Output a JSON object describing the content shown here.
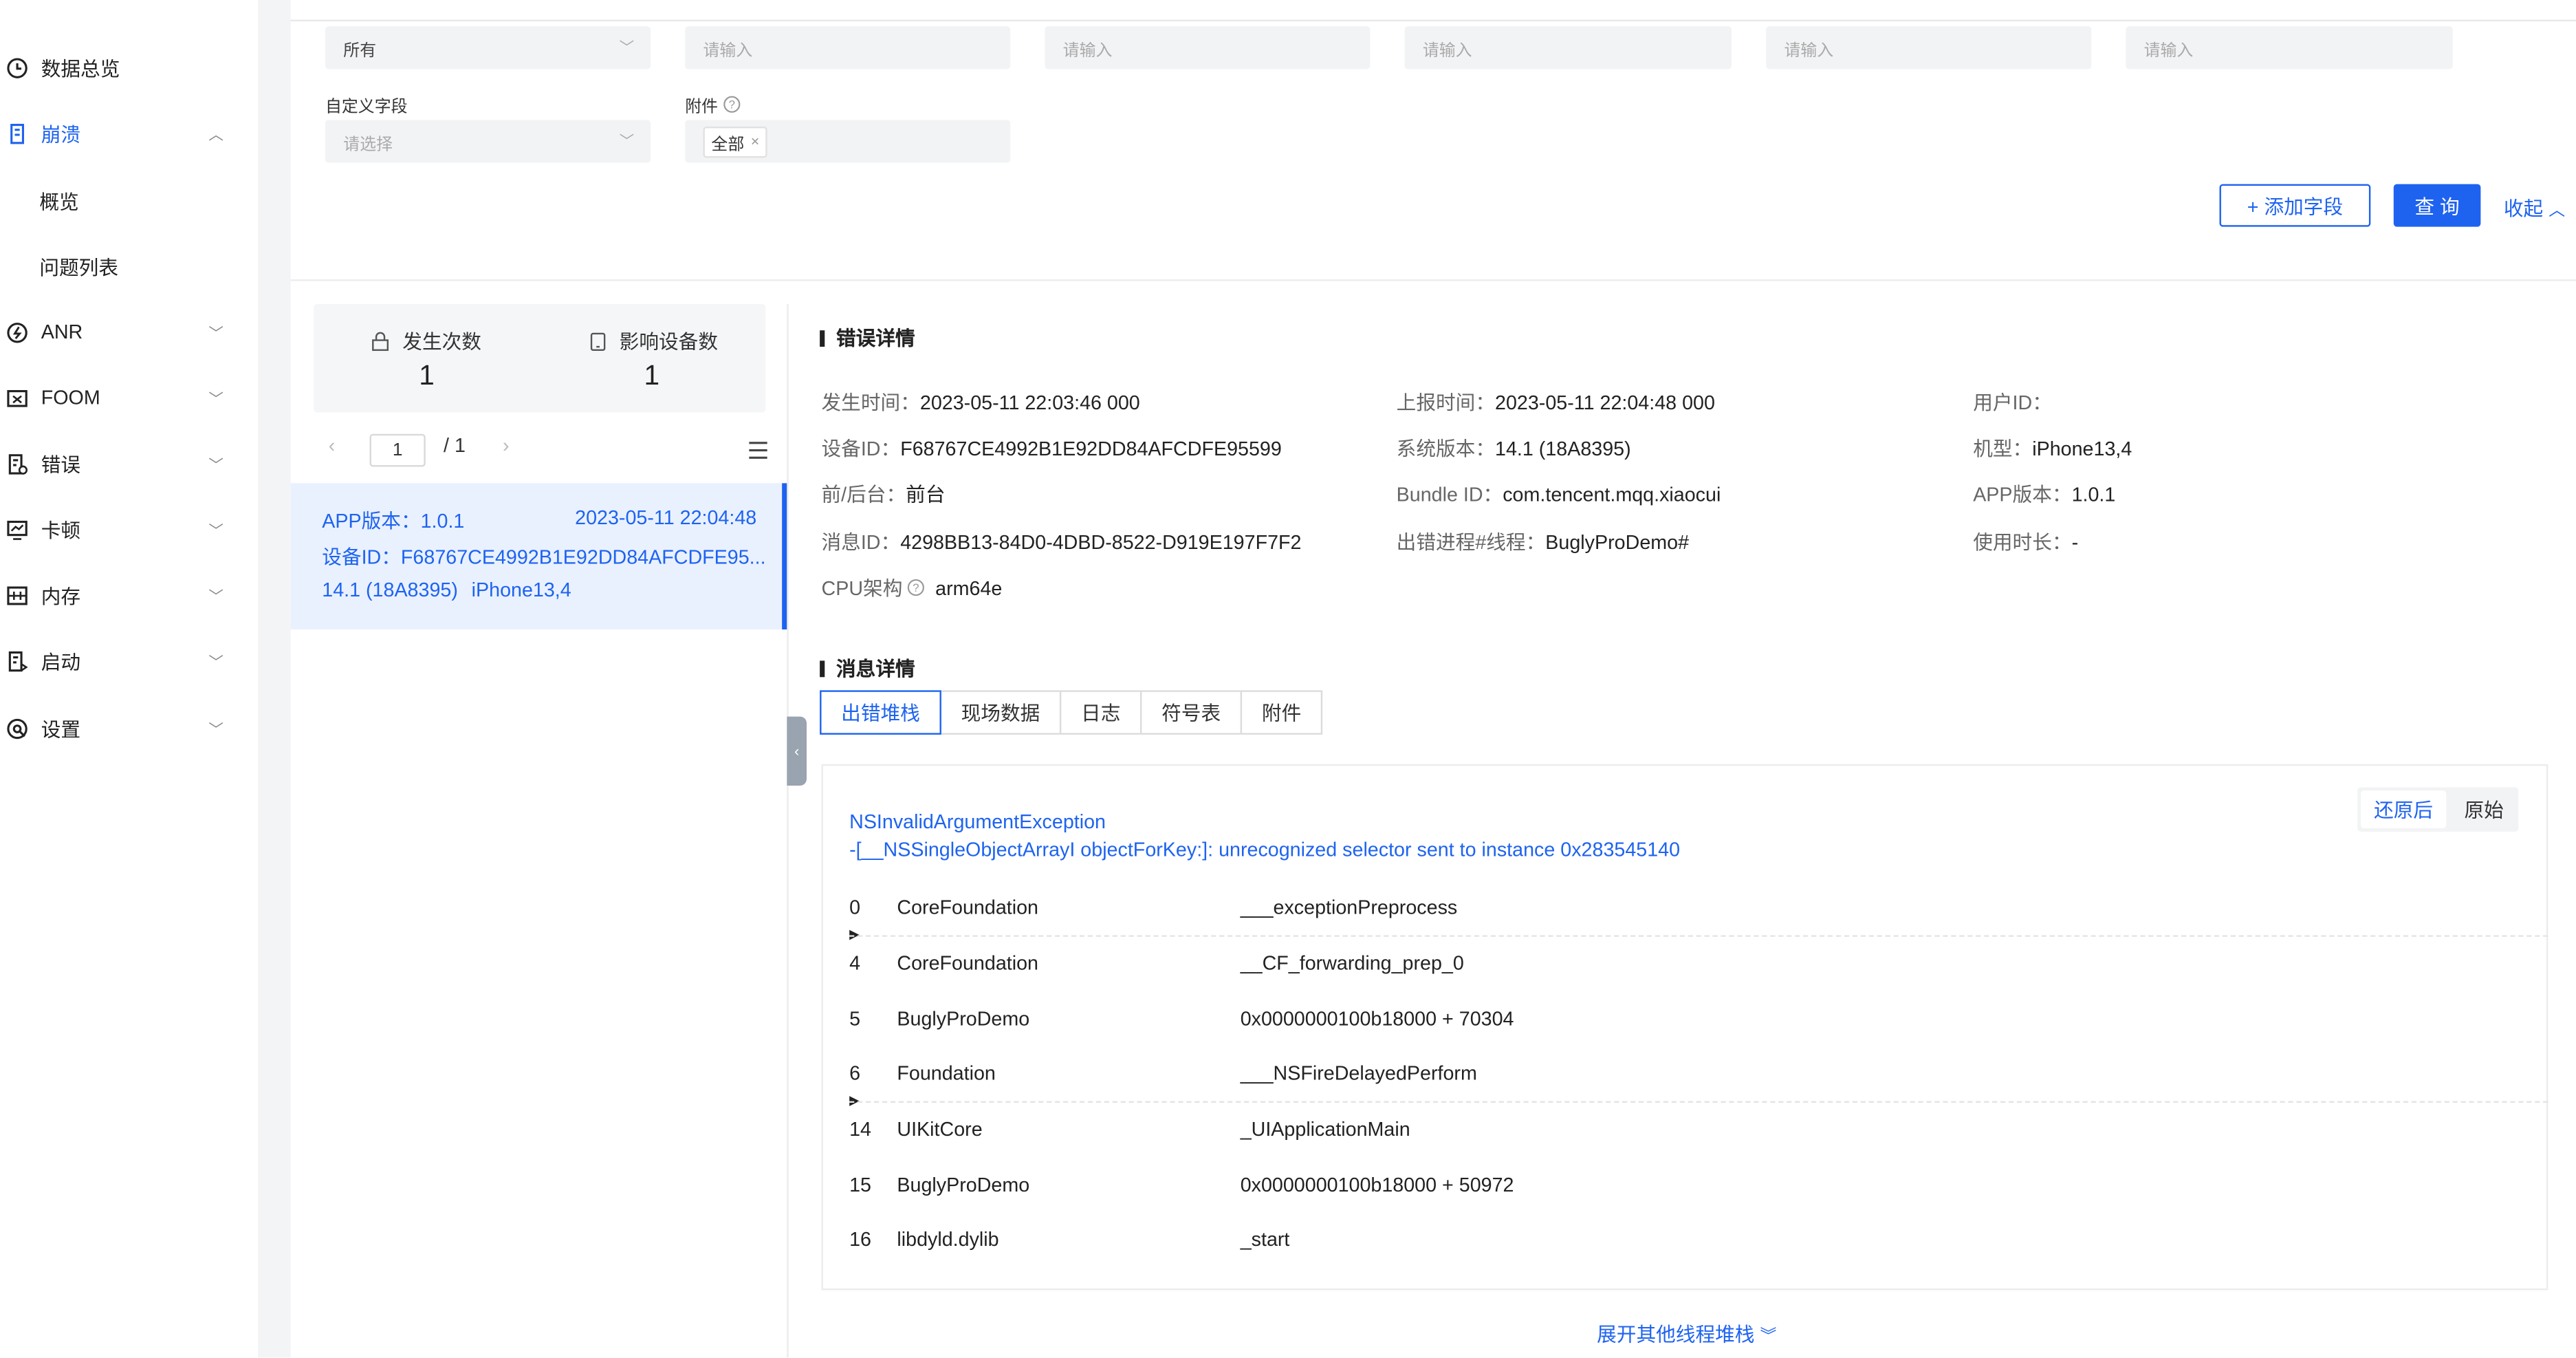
{
  "sidebar": {
    "items": [
      {
        "label": "数据总览",
        "icon": "clock-icon",
        "expanded": null
      },
      {
        "label": "崩溃",
        "icon": "crash-icon",
        "expanded": true,
        "active": true
      },
      {
        "label": "ANR",
        "icon": "anr-icon",
        "expanded": false
      },
      {
        "label": "FOOM",
        "icon": "foom-icon",
        "expanded": false
      },
      {
        "label": "错误",
        "icon": "error-icon",
        "expanded": false
      },
      {
        "label": "卡顿",
        "icon": "lag-icon",
        "expanded": false
      },
      {
        "label": "内存",
        "icon": "memory-icon",
        "expanded": false
      },
      {
        "label": "启动",
        "icon": "launch-icon",
        "expanded": false
      },
      {
        "label": "设置",
        "icon": "settings-icon",
        "expanded": false
      }
    ],
    "sub_items": [
      "概览",
      "问题列表"
    ]
  },
  "filters": {
    "row1": [
      "所有",
      "请输入",
      "请输入",
      "请输入",
      "请输入",
      "请输入"
    ],
    "custom_field": {
      "label": "自定义字段",
      "placeholder": "请选择"
    },
    "attachment": {
      "label": "附件",
      "tag": "全部"
    },
    "add_field_label": "+ 添加字段",
    "query_label": "查 询",
    "collapse_label": "收起"
  },
  "stats": {
    "occurrences": {
      "label": "发生次数",
      "value": "1"
    },
    "affected_devices": {
      "label": "影响设备数",
      "value": "1"
    }
  },
  "pager": {
    "current": "1",
    "total": "/ 1"
  },
  "list_card": {
    "app_version": "APP版本：1.0.1",
    "time": "2023-05-11 22:04:48",
    "device_id": "设备ID：F68767CE4992B1E92DD84AFCDFE95...",
    "os": "14.1 (18A8395)",
    "model": "iPhone13,4"
  },
  "error_detail": {
    "title": "错误详情",
    "fields": {
      "occur_time_k": "发生时间：",
      "occur_time_v": "2023-05-11 22:03:46 000",
      "report_time_k": "上报时间：",
      "report_time_v": "2023-05-11 22:04:48 000",
      "user_id_k": "用户ID：",
      "user_id_v": "",
      "device_id_k": "设备ID：",
      "device_id_v": "F68767CE4992B1E92DD84AFCDFE95599",
      "sys_ver_k": "系统版本：",
      "sys_ver_v": "14.1 (18A8395)",
      "model_k": "机型：",
      "model_v": "iPhone13,4",
      "fg_k": "前/后台：",
      "fg_v": "前台",
      "bundle_k": "Bundle ID：",
      "bundle_v": "com.tencent.mqq.xiaocui",
      "app_ver_k": "APP版本：",
      "app_ver_v": "1.0.1",
      "msg_id_k": "消息ID：",
      "msg_id_v": "4298BB13-84D0-4DBD-8522-D919E197F7F2",
      "process_k": "出错进程#线程：",
      "process_v": "BuglyProDemo#",
      "duration_k": "使用时长：",
      "duration_v": "-",
      "cpu_k": "CPU架构",
      "cpu_v": "arm64e"
    }
  },
  "message_detail": {
    "title": "消息详情",
    "tabs": [
      "出错堆栈",
      "现场数据",
      "日志",
      "符号表",
      "附件"
    ],
    "toggle": [
      "还原后",
      "原始"
    ],
    "exception_name": "NSInvalidArgumentException",
    "exception_reason": "-[__NSSingleObjectArrayI objectForKey:]: unrecognized selector sent to instance 0x283545140",
    "frames": [
      {
        "idx": "0",
        "module": "CoreFoundation",
        "symbol": "___exceptionPreprocess"
      },
      {
        "idx": "4",
        "module": "CoreFoundation",
        "symbol": "__CF_forwarding_prep_0"
      },
      {
        "idx": "5",
        "module": "BuglyProDemo",
        "symbol": "0x0000000100b18000 + 70304"
      },
      {
        "idx": "6",
        "module": "Foundation",
        "symbol": "___NSFireDelayedPerform"
      },
      {
        "idx": "14",
        "module": "UIKitCore",
        "symbol": "_UIApplicationMain"
      },
      {
        "idx": "15",
        "module": "BuglyProDemo",
        "symbol": "0x0000000100b18000 + 50972"
      },
      {
        "idx": "16",
        "module": "libdyld.dylib",
        "symbol": "_start"
      }
    ],
    "expand_label": "展开其他线程堆栈"
  },
  "colors": {
    "accent": "#1e63f0",
    "selected_bg": "#e9f1ff"
  }
}
